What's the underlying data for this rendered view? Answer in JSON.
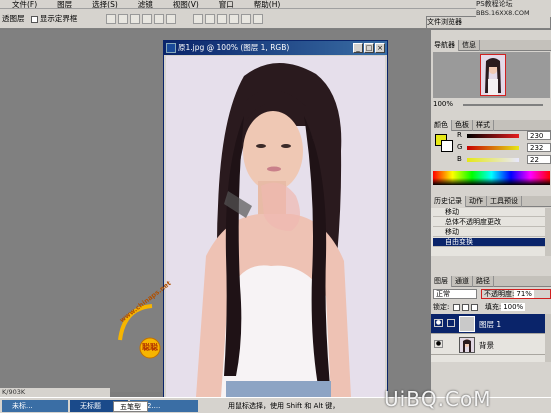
{
  "menubar": {
    "items": [
      "文件(F)",
      "图层",
      "选择(S)",
      "滤镜",
      "视图(V)",
      "窗口",
      "帮助(H)"
    ]
  },
  "optbar": {
    "left_label": "透图层",
    "show_bounds_label": "显示定界框"
  },
  "top_right": {
    "tab_label": "文件浏览器",
    "site_a": "PS教程论坛",
    "site_b": "BBS.16XX8.COM"
  },
  "document": {
    "title": "原1.jpg @ 100% (图层 1, RGB)"
  },
  "watermark": {
    "url": "www.chinaps.net",
    "name": "聪聪"
  },
  "panels": {
    "navigator": {
      "tabs": [
        "导航器",
        "信息"
      ],
      "zoom": "100%"
    },
    "color": {
      "tabs": [
        "颜色",
        "色板",
        "样式"
      ],
      "channels": [
        {
          "label": "R",
          "value": "230",
          "color": "#e61e1e"
        },
        {
          "label": "G",
          "value": "232",
          "color": "#1ec81e"
        },
        {
          "label": "B",
          "value": "22",
          "color": "#1e32e6"
        }
      ],
      "fg_color": "#e6e816"
    },
    "history": {
      "tabs": [
        "历史记录",
        "动作",
        "工具预设"
      ],
      "items": [
        "移动",
        "总体不透明度更改",
        "移动",
        "自由变换"
      ]
    },
    "layers": {
      "tabs": [
        "图层",
        "通道",
        "路径"
      ],
      "blend_mode": "正常",
      "opacity_label": "不透明度:",
      "opacity_value": "71%",
      "lock_label": "锁定:",
      "fill_label": "填充:",
      "fill_value": "100%",
      "rows": [
        {
          "name": "图层 1",
          "selected": true
        },
        {
          "name": "背景",
          "selected": false
        }
      ]
    }
  },
  "statusbar": {
    "text": "K/903K"
  },
  "taskbar": {
    "items": [
      "未标...",
      "原2....",
      "无标题",
      "五笔型"
    ],
    "hint": "用鼠标选择，使用 Shift 和 Alt 键，"
  },
  "brand": {
    "text": "UiBQ.CoM"
  }
}
